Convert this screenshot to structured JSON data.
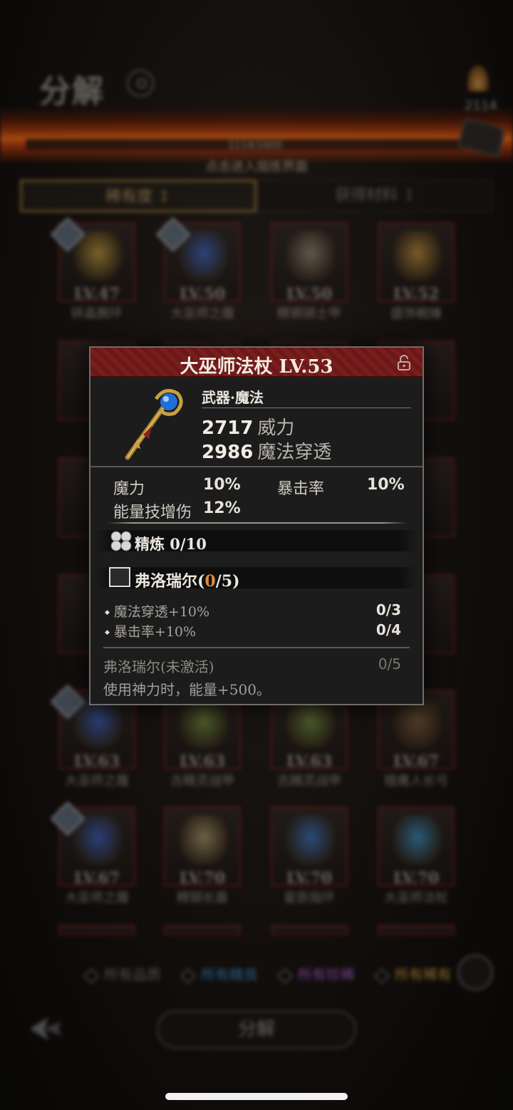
{
  "header": {
    "title": "分解",
    "currency_count": "2114",
    "fire_value": "1114/1600",
    "fire_hint": "点击进入熔炼界面"
  },
  "sort_tabs": {
    "active_label": "稀有度 ↕",
    "inactive_label": "获得材料 ↕"
  },
  "items_bg": [
    {
      "level": "LV.47",
      "name": "碎晶腕环",
      "color": "#b8953a"
    },
    {
      "level": "LV.50",
      "name": "大巫师之履",
      "color": "#3b5fb8"
    },
    {
      "level": "LV.50",
      "name": "精钢骑士甲",
      "color": "#8c8070"
    },
    {
      "level": "LV.52",
      "name": "盛饰戦锤",
      "color": "#b88a3a"
    },
    {
      "level": "LV.63",
      "name": "大巫师之履",
      "color": "#3b5fb8"
    },
    {
      "level": "LV.63",
      "name": "古精灵战甲",
      "color": "#6f8a3a"
    },
    {
      "level": "LV.63",
      "name": "古精灵战甲",
      "color": "#6f8a3a"
    },
    {
      "level": "LV.67",
      "name": "猎鹰人长弓",
      "color": "#7a5a3a"
    },
    {
      "level": "LV.67",
      "name": "大巫师之履",
      "color": "#3b5fb8"
    },
    {
      "level": "LV.70",
      "name": "精钢长盾",
      "color": "#a8936a"
    },
    {
      "level": "LV.70",
      "name": "星辰指环",
      "color": "#3a6fb8"
    },
    {
      "level": "LV.70",
      "name": "大巫师法杖",
      "color": "#3a8ab8"
    }
  ],
  "filters": [
    {
      "label": "所有品质",
      "accent": "#7d776e"
    },
    {
      "label": "所有精良",
      "accent": "#3b8fd6"
    },
    {
      "label": "所有珍稀",
      "accent": "#b35fd6"
    },
    {
      "label": "所有稀有",
      "accent": "#d6a23b"
    }
  ],
  "decompose_button": "分解",
  "tooltip": {
    "title": "大巫师法杖 LV.53",
    "category": "武器·魔法",
    "stats": [
      {
        "value": "2717",
        "label": "威力"
      },
      {
        "value": "2986",
        "label": "魔法穿透"
      }
    ],
    "sub_stats": [
      {
        "label": "魔力",
        "value": "10%"
      },
      {
        "label": "暴击率",
        "value": "10%"
      },
      {
        "label": "能量技增伤",
        "value": "12%"
      }
    ],
    "refine": "精炼 0/10",
    "set_name_prefix": "弗洛瑞尔(",
    "set_current": "0",
    "set_name_suffix": "/5)",
    "set_bonuses": [
      {
        "label": "魔法穿透+10%",
        "value": "0/3"
      },
      {
        "label": "暴击率+10%",
        "value": "0/4"
      }
    ],
    "inactive_label": "弗洛瑞尔(未激活)",
    "inactive_value": "0/5",
    "description": "使用神力时，能量+500。",
    "colors": {
      "header": "#7a1d1d",
      "set_current": "#e08a3b",
      "panel": "#1c1c1d"
    }
  }
}
